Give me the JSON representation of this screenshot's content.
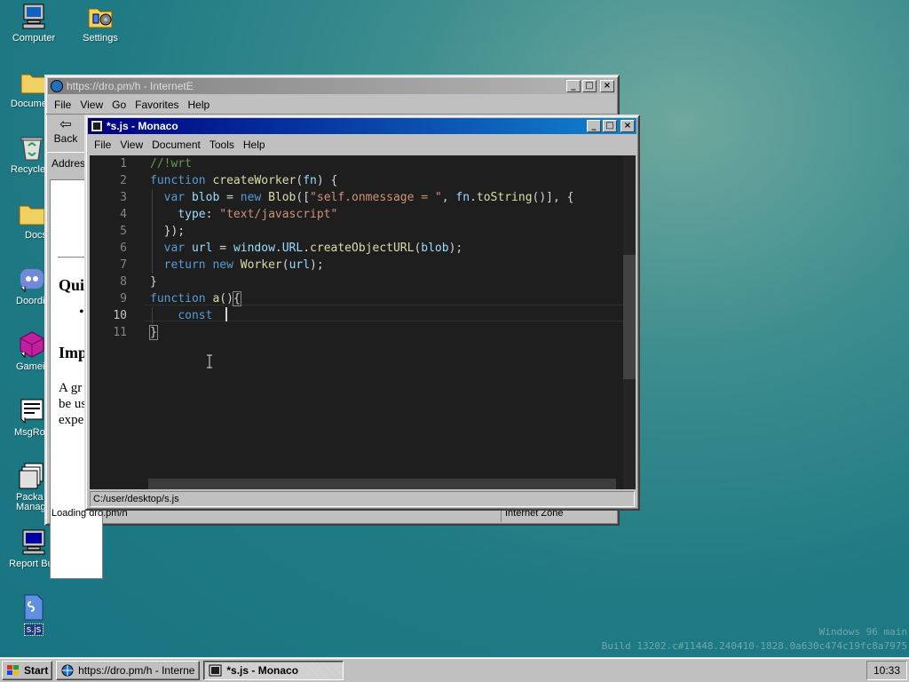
{
  "desktop": {
    "icons": [
      {
        "label": "Computer"
      },
      {
        "label": "Settings"
      },
      {
        "label": "Docume"
      },
      {
        "label": "Recycle"
      },
      {
        "label": "Docs"
      },
      {
        "label": "Doordis"
      },
      {
        "label": "Gamein"
      },
      {
        "label": "MsgRoo"
      },
      {
        "label": "Packa Manag"
      },
      {
        "label": "Report Bug"
      },
      {
        "label": "s.js"
      }
    ],
    "watermark": {
      "line1": "Windows 96 main",
      "line2": "Build 13202.c#11448.240410-1828.0a630c474c19fc8a7975"
    }
  },
  "browser": {
    "title": "https://dro.pm/h - InternetE",
    "menu": [
      "File",
      "View",
      "Go",
      "Favorites",
      "Help"
    ],
    "back_label": "Back",
    "address_label": "Addres",
    "page_text": {
      "heading1": "Qui",
      "heading2": "Imp",
      "para_lines": [
        "A gr",
        "be us",
        "expe"
      ]
    },
    "status_left": "Loading dro.pm/h",
    "status_right": "Internet Zone"
  },
  "editor": {
    "title": "*s.js - Monaco",
    "menu": [
      "File",
      "View",
      "Document",
      "Tools",
      "Help"
    ],
    "line_numbers": [
      "1",
      "2",
      "3",
      "4",
      "5",
      "6",
      "7",
      "8",
      "9",
      "10",
      "11"
    ],
    "statusbar": "C:/user/desktop/s.js"
  },
  "taskbar": {
    "start_label": "Start",
    "tasks": [
      {
        "label": "https://dro.pm/h - InternetE"
      },
      {
        "label": "*s.js - Monaco"
      }
    ],
    "clock": "10:33"
  },
  "colors": {
    "title_active": "#000080",
    "editor_bg": "#1e1e1e",
    "keyword": "#569cd6",
    "string": "#ce9178",
    "comment": "#6a9955"
  }
}
